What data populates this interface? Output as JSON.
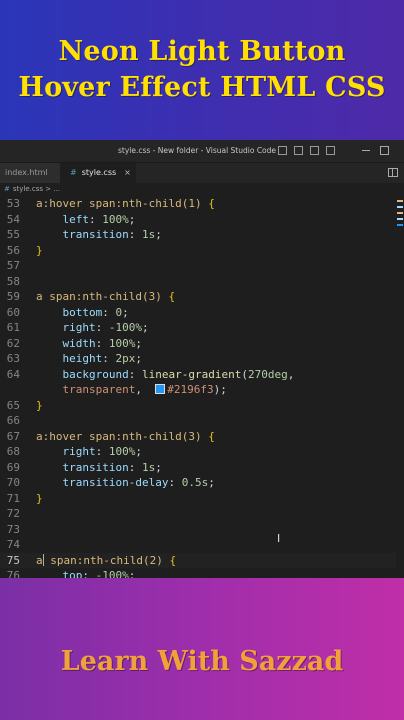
{
  "banner_top": {
    "line1": "Neon Light Button",
    "line2": "Hover Effect HTML CSS"
  },
  "editor": {
    "window_title": "style.css - New folder - Visual Studio Code",
    "tabs": [
      {
        "label": "index.html",
        "active": false
      },
      {
        "label": "style.css",
        "active": true
      }
    ],
    "breadcrumb": "style.css > ...",
    "active_line": 75,
    "accent_color_swatch": "#2196f3"
  },
  "banner_bottom": {
    "brand": "Learn With Sazzad"
  }
}
